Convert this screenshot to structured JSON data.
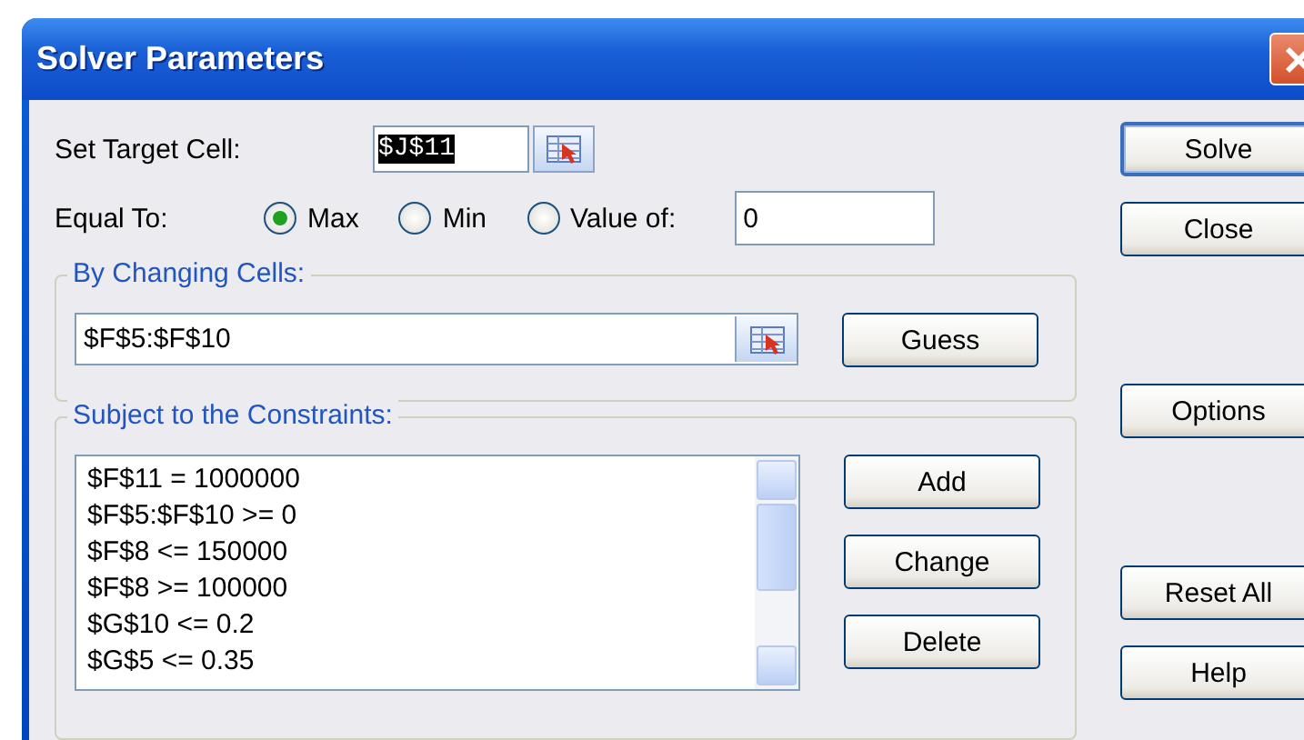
{
  "window": {
    "title": "Solver Parameters"
  },
  "target_cell": {
    "label": "Set Target Cell:",
    "value": "$J$11",
    "text_selected": true
  },
  "equal_to": {
    "label": "Equal To:",
    "options": [
      {
        "label": "Max",
        "selected": true
      },
      {
        "label": "Min",
        "selected": false
      },
      {
        "label": "Value of:",
        "selected": false
      }
    ],
    "value": "0"
  },
  "changing_cells": {
    "group_label": "By Changing Cells:",
    "value": "$F$5:$F$10",
    "button": "Guess"
  },
  "constraints": {
    "group_label": "Subject to the Constraints:",
    "items": [
      "$F$11 = 1000000",
      "$F$5:$F$10 >= 0",
      "$F$8 <= 150000",
      "$F$8 >= 100000",
      "$G$10 <= 0.2",
      "$G$5 <= 0.35"
    ],
    "buttons": [
      "Add",
      "Change",
      "Delete"
    ]
  },
  "side_buttons": [
    {
      "label": "Solve",
      "default": true
    },
    {
      "label": "Close",
      "default": false
    },
    {
      "label": "Options",
      "default": false
    },
    {
      "label": "Reset All",
      "default": false
    },
    {
      "label": "Help",
      "default": false
    }
  ]
}
